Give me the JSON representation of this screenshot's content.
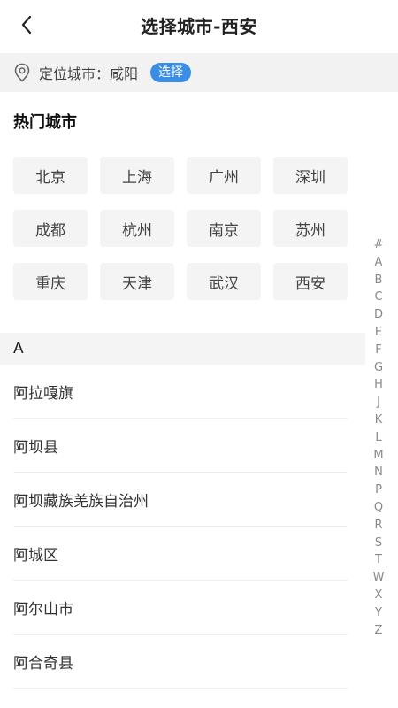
{
  "header": {
    "title": "选择城市-西安"
  },
  "location": {
    "label": "定位城市：",
    "city": "咸阳",
    "select_label": "选择"
  },
  "hot": {
    "title": "热门城市",
    "cities": [
      "北京",
      "上海",
      "广州",
      "深圳",
      "成都",
      "杭州",
      "南京",
      "苏州",
      "重庆",
      "天津",
      "武汉",
      "西安"
    ]
  },
  "section": {
    "letter": "A"
  },
  "city_list": [
    "阿拉嘎旗",
    "阿坝县",
    "阿坝藏族羌族自治州",
    "阿城区",
    "阿尔山市",
    "阿合奇县"
  ],
  "index_letters": [
    "#",
    "A",
    "B",
    "C",
    "D",
    "E",
    "F",
    "G",
    "H",
    "J",
    "K",
    "L",
    "M",
    "N",
    "P",
    "Q",
    "R",
    "S",
    "T",
    "W",
    "X",
    "Y",
    "Z"
  ],
  "colors": {
    "accent": "#3a8ee6"
  }
}
